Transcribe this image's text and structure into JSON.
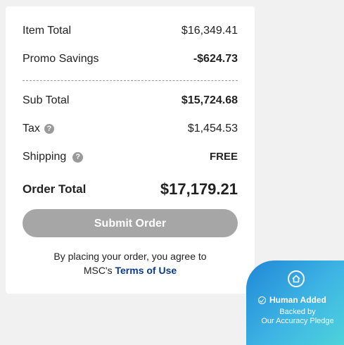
{
  "summary": {
    "item_total_label": "Item Total",
    "item_total_value": "$16,349.41",
    "promo_label": "Promo Savings",
    "promo_value": "-$624.73",
    "subtotal_label": "Sub Total",
    "subtotal_value": "$15,724.68",
    "tax_label": "Tax",
    "tax_value": "$1,454.53",
    "shipping_label": "Shipping",
    "shipping_value": "FREE",
    "order_total_label": "Order Total",
    "order_total_value": "$17,179.21"
  },
  "submit_label": "Submit Order",
  "agreement": {
    "line1": "By placing your order, you agree to",
    "prefix": "MSC's ",
    "link": "Terms of Use"
  },
  "badge": {
    "title": "Human Added",
    "line1": "Backed by",
    "line2": "Our Accuracy Pledge"
  },
  "colors": {
    "savings_green": "#1c7a4a",
    "link_blue": "#0b3a8c",
    "button_disabled": "#a6a6a6"
  }
}
